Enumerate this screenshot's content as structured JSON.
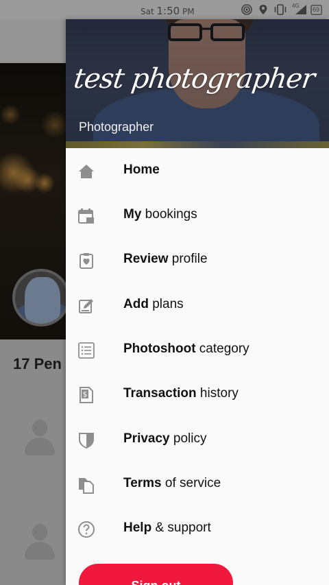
{
  "status_bar": {
    "time_day": "Sat",
    "time_value": "1:50",
    "time_period": "PM",
    "network": "4G",
    "battery": "69"
  },
  "background": {
    "title": "17 Pen"
  },
  "drawer": {
    "name": "test photographer",
    "role": "Photographer",
    "menu": [
      {
        "bold": "Home",
        "rest": ""
      },
      {
        "bold": "My",
        "rest": " bookings"
      },
      {
        "bold": "Review",
        "rest": " profile"
      },
      {
        "bold": "Add",
        "rest": " plans"
      },
      {
        "bold": "Photoshoot",
        "rest": " category"
      },
      {
        "bold": "Transaction",
        "rest": " history"
      },
      {
        "bold": "Privacy",
        "rest": " policy"
      },
      {
        "bold": "Terms",
        "rest": " of service"
      },
      {
        "bold": "Help",
        "rest": " & support"
      }
    ],
    "sign_out": "Sign out"
  },
  "colors": {
    "accent": "#f0183d",
    "icon_gray": "#8e8e8e",
    "overlay": "#8a8a8a"
  }
}
